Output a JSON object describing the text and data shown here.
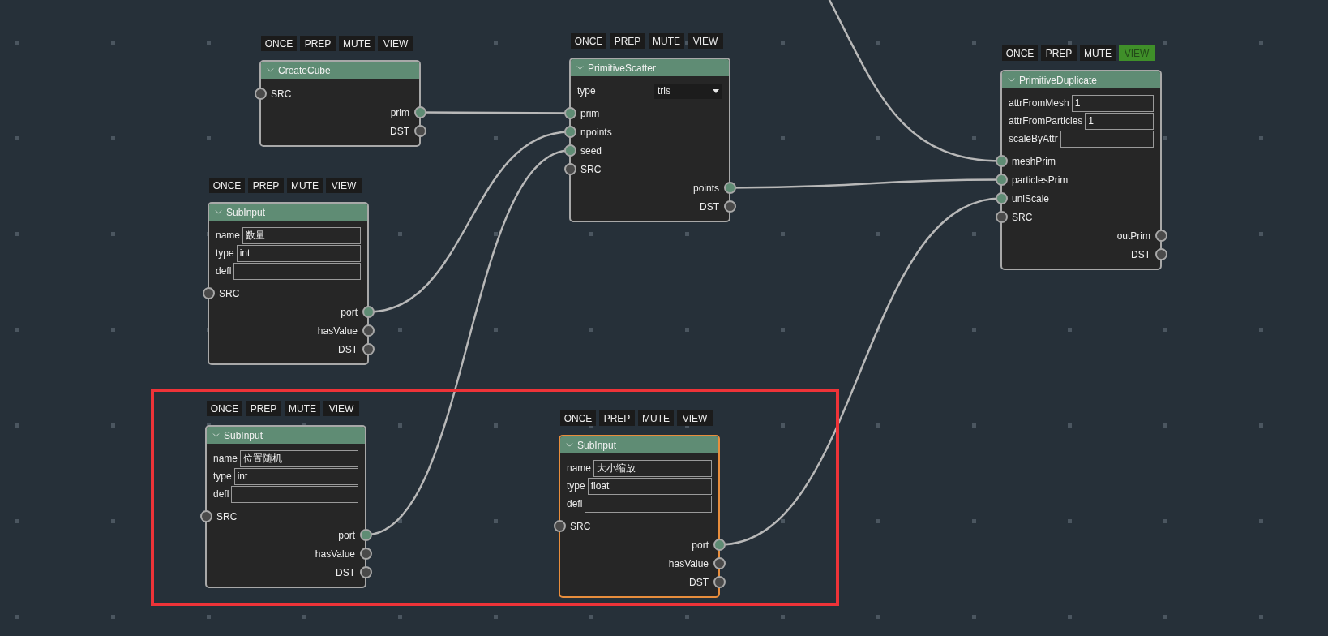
{
  "nodes": [
    {
      "title": "CreateCube",
      "selected": false,
      "toolbar": [
        {
          "label": "ONCE",
          "on": false
        },
        {
          "label": "PREP",
          "on": false
        },
        {
          "label": "MUTE",
          "on": false
        },
        {
          "label": "VIEW",
          "on": false
        }
      ],
      "sockets": [
        {
          "label": "SRC",
          "kind": "input",
          "connected": false
        },
        {
          "label": "prim",
          "kind": "output",
          "connected": true
        },
        {
          "label": "DST",
          "kind": "output",
          "connected": false
        }
      ]
    },
    {
      "title": "PrimitiveScatter",
      "selected": false,
      "toolbar": [
        {
          "label": "ONCE",
          "on": false
        },
        {
          "label": "PREP",
          "on": false
        },
        {
          "label": "MUTE",
          "on": false
        },
        {
          "label": "VIEW",
          "on": false
        }
      ],
      "params": [
        {
          "label": "type",
          "kind": "select",
          "value": "tris"
        }
      ],
      "sockets": [
        {
          "label": "prim",
          "kind": "input",
          "connected": true
        },
        {
          "label": "npoints",
          "kind": "input",
          "connected": true
        },
        {
          "label": "seed",
          "kind": "input",
          "connected": true
        },
        {
          "label": "SRC",
          "kind": "input",
          "connected": false
        },
        {
          "label": "points",
          "kind": "output",
          "connected": true
        },
        {
          "label": "DST",
          "kind": "output",
          "connected": false
        }
      ]
    },
    {
      "title": "PrimitiveDuplicate",
      "selected": false,
      "toolbar": [
        {
          "label": "ONCE",
          "on": false
        },
        {
          "label": "PREP",
          "on": false
        },
        {
          "label": "MUTE",
          "on": false
        },
        {
          "label": "VIEW",
          "on": true
        }
      ],
      "params": [
        {
          "label": "attrFromMesh",
          "kind": "text",
          "value": "1"
        },
        {
          "label": "attrFromParticles",
          "kind": "text",
          "value": "1"
        },
        {
          "label": "scaleByAttr",
          "kind": "text"
        }
      ],
      "sockets": [
        {
          "label": "meshPrim",
          "kind": "input",
          "connected": true
        },
        {
          "label": "particlesPrim",
          "kind": "input",
          "connected": true
        },
        {
          "label": "uniScale",
          "kind": "input",
          "connected": true
        },
        {
          "label": "SRC",
          "kind": "input",
          "connected": false
        },
        {
          "label": "outPrim",
          "kind": "output",
          "connected": false
        },
        {
          "label": "DST",
          "kind": "output",
          "connected": false
        }
      ]
    },
    {
      "title": "SubInput",
      "selected": false,
      "toolbar": [
        {
          "label": "ONCE",
          "on": false
        },
        {
          "label": "PREP",
          "on": false
        },
        {
          "label": "MUTE",
          "on": false
        },
        {
          "label": "VIEW",
          "on": false
        }
      ],
      "params": [
        {
          "label": "name",
          "kind": "text",
          "value": "数量"
        },
        {
          "label": "type",
          "kind": "text",
          "value": "int"
        },
        {
          "label": "defl",
          "kind": "text"
        }
      ],
      "sockets": [
        {
          "label": "SRC",
          "kind": "input",
          "connected": false
        },
        {
          "label": "port",
          "kind": "output",
          "connected": true
        },
        {
          "label": "hasValue",
          "kind": "output",
          "connected": false
        },
        {
          "label": "DST",
          "kind": "output",
          "connected": false
        }
      ]
    },
    {
      "title": "SubInput",
      "selected": false,
      "toolbar": [
        {
          "label": "ONCE",
          "on": false
        },
        {
          "label": "PREP",
          "on": false
        },
        {
          "label": "MUTE",
          "on": false
        },
        {
          "label": "VIEW",
          "on": false
        }
      ],
      "params": [
        {
          "label": "name",
          "kind": "text",
          "value": "位置随机"
        },
        {
          "label": "type",
          "kind": "text",
          "value": "int"
        },
        {
          "label": "defl",
          "kind": "text"
        }
      ],
      "sockets": [
        {
          "label": "SRC",
          "kind": "input",
          "connected": false
        },
        {
          "label": "port",
          "kind": "output",
          "connected": true
        },
        {
          "label": "hasValue",
          "kind": "output",
          "connected": false
        },
        {
          "label": "DST",
          "kind": "output",
          "connected": false
        }
      ]
    },
    {
      "title": "SubInput",
      "selected": true,
      "toolbar": [
        {
          "label": "ONCE",
          "on": false
        },
        {
          "label": "PREP",
          "on": false
        },
        {
          "label": "MUTE",
          "on": false
        },
        {
          "label": "VIEW",
          "on": false
        }
      ],
      "params": [
        {
          "label": "name",
          "kind": "text",
          "value": "大小缩放"
        },
        {
          "label": "type",
          "kind": "text",
          "value": "float"
        },
        {
          "label": "defl",
          "kind": "text"
        }
      ],
      "sockets": [
        {
          "label": "SRC",
          "kind": "input",
          "connected": false
        },
        {
          "label": "port",
          "kind": "output",
          "connected": true
        },
        {
          "label": "hasValue",
          "kind": "output",
          "connected": false
        },
        {
          "label": "DST",
          "kind": "output",
          "connected": false
        }
      ]
    }
  ]
}
